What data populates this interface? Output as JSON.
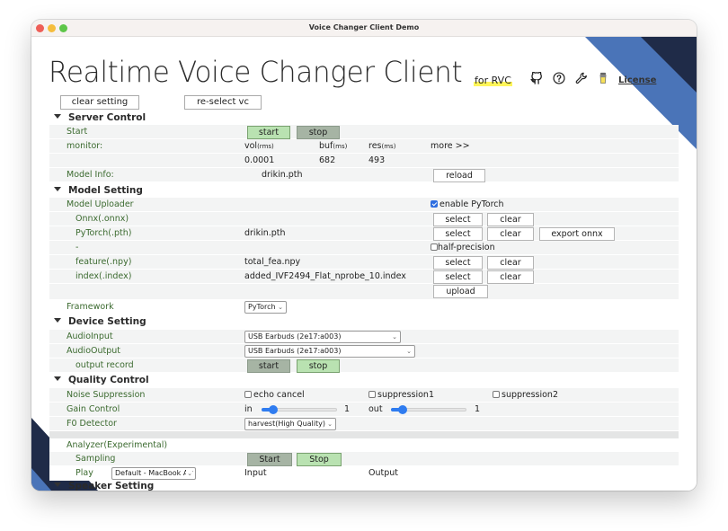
{
  "window": {
    "title": "Voice Changer Client Demo"
  },
  "header": {
    "title": "Realtime Voice Changer Client",
    "subtitle": "for RVC",
    "icons": [
      "github-icon",
      "help-icon",
      "wrench-icon",
      "coffee-cup-icon"
    ],
    "license_label": "License"
  },
  "top_buttons": {
    "clear_setting": "clear setting",
    "reselect_vc": "re-select vc"
  },
  "server_control": {
    "heading": "Server Control",
    "start_label": "Start",
    "start_btn": "start",
    "stop_btn": "stop",
    "monitor_label": "monitor:",
    "vol_label": "vol",
    "vol_unit": "(rms)",
    "buf_label": "buf",
    "buf_unit": "(ms)",
    "res_label": "res",
    "res_unit": "(ms)",
    "more_label": "more >>",
    "vol_value": "0.0001",
    "buf_value": "682",
    "res_value": "493",
    "model_info_label": "Model Info:",
    "model_info_value": "drikin.pth",
    "reload_btn": "reload"
  },
  "model_setting": {
    "heading": "Model Setting",
    "uploader_label": "Model Uploader",
    "enable_pytorch_label": "enable PyTorch",
    "enable_pytorch_checked": true,
    "onnx_label": "Onnx(.onnx)",
    "pytorch_label": "PyTorch(.pth)",
    "pytorch_file": "drikin.pth",
    "dash_label": "-",
    "half_precision_label": "half-precision",
    "half_precision_checked": false,
    "feature_label": "feature(.npy)",
    "feature_file": "total_fea.npy",
    "index_label": "index(.index)",
    "index_file": "added_IVF2494_Flat_nprobe_10.index",
    "select_btn": "select",
    "clear_btn": "clear",
    "export_onnx_btn": "export onnx",
    "upload_btn": "upload",
    "framework_label": "Framework",
    "framework_value": "PyTorch"
  },
  "device_setting": {
    "heading": "Device Setting",
    "audio_input_label": "AudioInput",
    "audio_input_value": "USB Earbuds (2e17:a003)",
    "audio_output_label": "AudioOutput",
    "audio_output_value": "USB Earbuds (2e17:a003)",
    "output_record_label": "output record",
    "start_btn": "start",
    "stop_btn": "stop"
  },
  "quality_control": {
    "heading": "Quality Control",
    "noise_label": "Noise Suppression",
    "echo_cancel_label": "echo cancel",
    "suppression1_label": "suppression1",
    "suppression2_label": "suppression2",
    "gain_label": "Gain Control",
    "in_label": "in",
    "in_value": "1",
    "in_fraction": 0.15,
    "out_label": "out",
    "out_value": "1",
    "out_fraction": 0.15,
    "f0_label": "F0 Detector",
    "f0_value": "harvest(High Quality)",
    "analyzer_label": "Analyzer(Experimental)",
    "sampling_label": "Sampling",
    "sampling_start_btn": "Start",
    "sampling_stop_btn": "Stop",
    "play_label": "Play",
    "play_device_value": "Default - MacBook Air",
    "input_label": "Input",
    "output_label": "Output"
  },
  "speaker_setting": {
    "heading": "Speaker Setting"
  },
  "colors": {
    "accent_blue": "#4a74b8",
    "navy": "#1f2b48",
    "label_green": "#3b6a2f",
    "active_green": "#b9e2b1",
    "inactive_gray": "#a6b4a4"
  }
}
